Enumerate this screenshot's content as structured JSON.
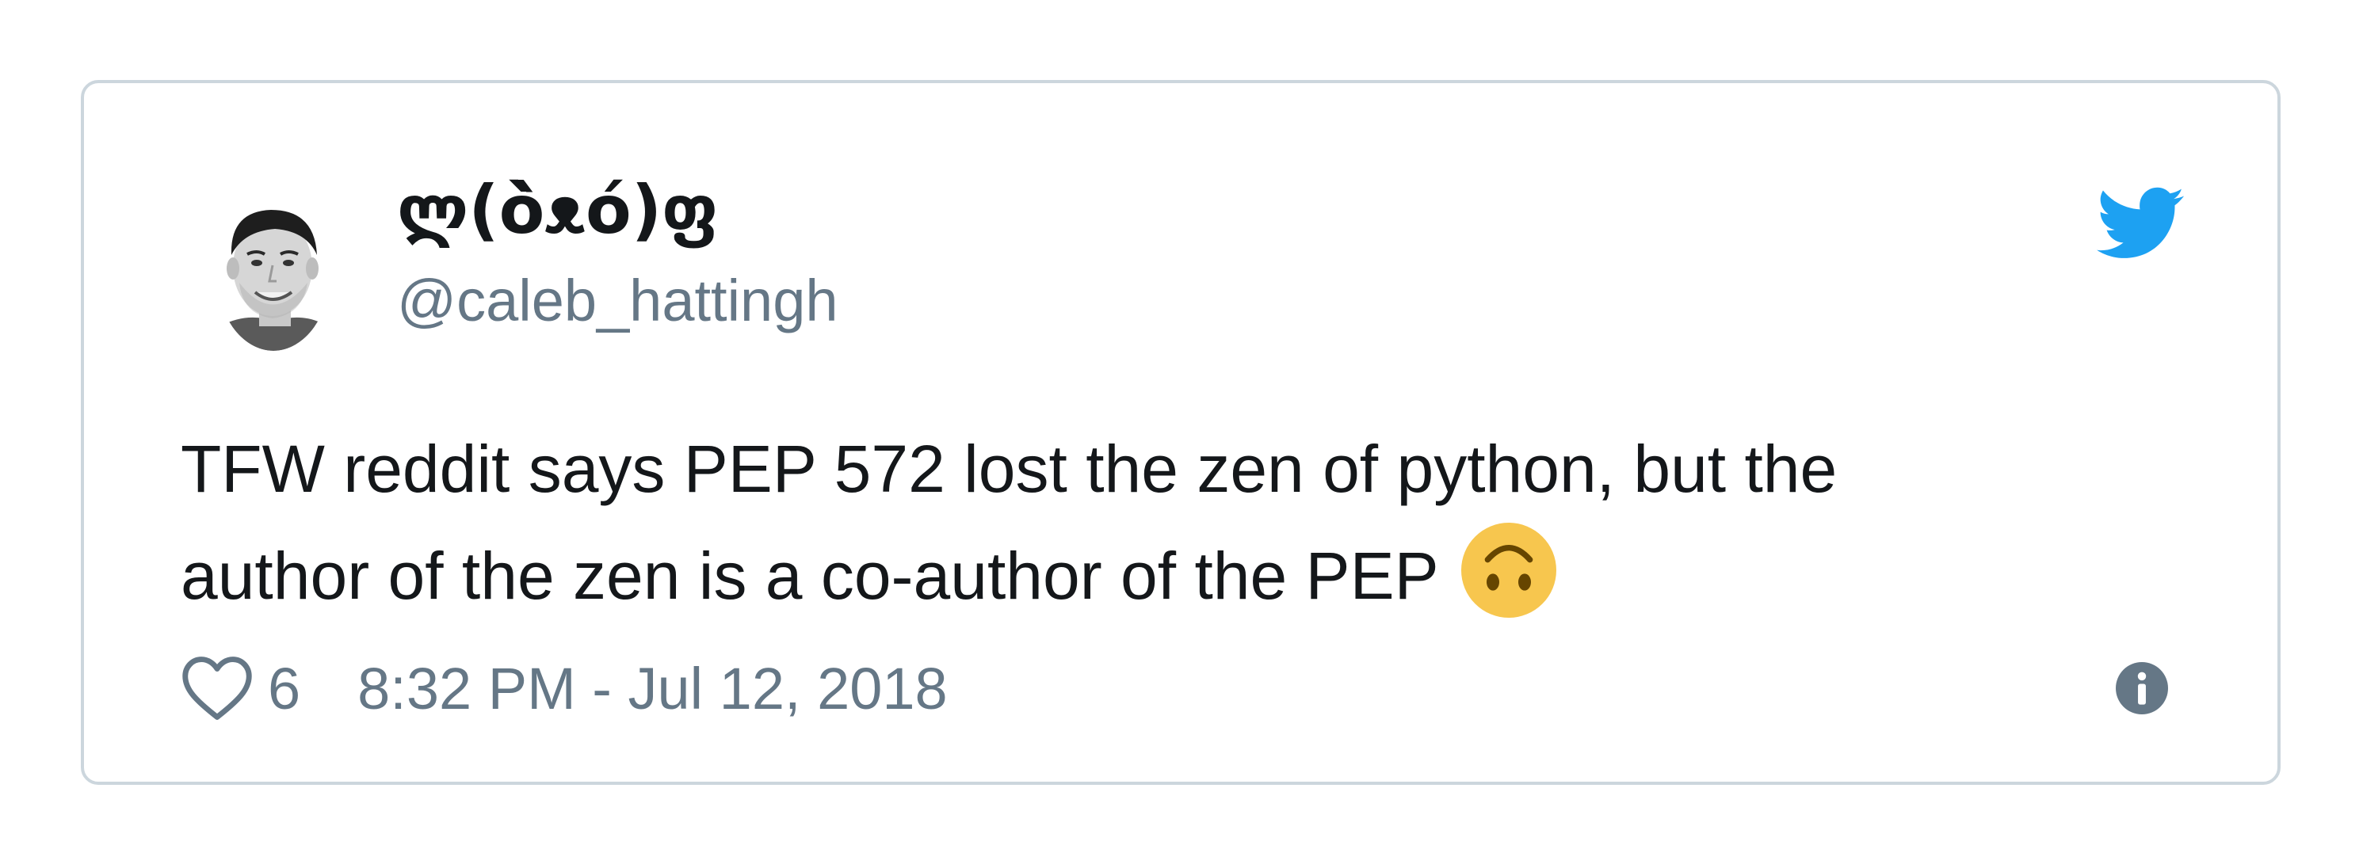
{
  "tweet": {
    "display_name": "ლ(ò̀ᴥó)ფ",
    "handle": "@caleb_hattingh",
    "text_lines": [
      "TFW reddit says PEP 572 lost the zen of python, but the",
      "author of the zen is a co-author of the PEP"
    ],
    "emoji": "upside-down-face-emoji",
    "like_count": "6",
    "timestamp": "8:32 PM - Jul 12, 2018"
  },
  "icons": {
    "brand": "twitter-bird-icon",
    "like": "heart-icon",
    "info": "info-icon"
  },
  "colors": {
    "twitter_blue": "#1da1f2",
    "text": "#14171a",
    "secondary_text": "#657786",
    "border": "#ccd6dd",
    "emoji": "#f7c64e"
  }
}
